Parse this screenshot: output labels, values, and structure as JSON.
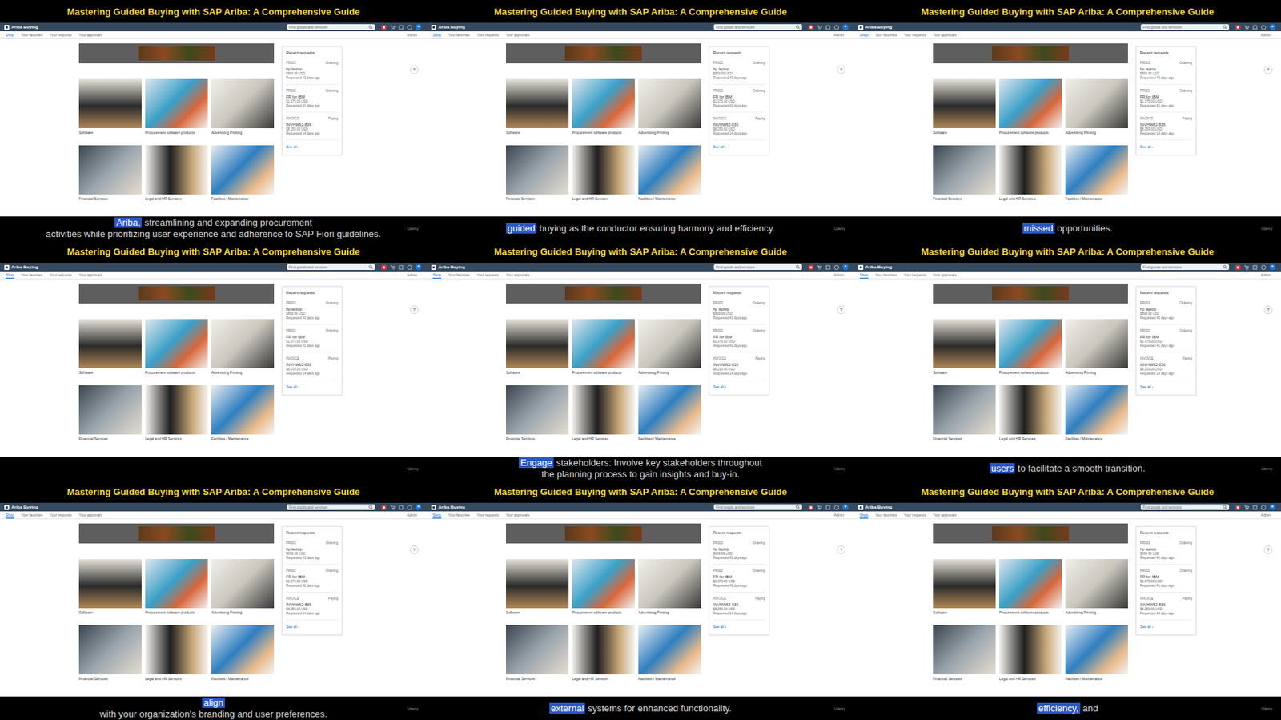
{
  "course_title": "Mastering Guided Buying with SAP Ariba: A Comprehensive Guide",
  "watermark": "Udemy",
  "app": {
    "logo": "Ariba Buying",
    "search": {
      "placeholder": "Find goods and services"
    },
    "user": "Admin",
    "tabs": [
      {
        "label": "Shop",
        "selected": true
      },
      {
        "label": "Your favorites",
        "selected": false
      },
      {
        "label": "Your requests",
        "selected": false
      },
      {
        "label": "Your approvals",
        "selected": false
      }
    ],
    "categories": [
      {
        "label": "Software"
      },
      {
        "label": "Procurement software products"
      },
      {
        "label": "Advertising Printing"
      },
      {
        "label": "Financial Services"
      },
      {
        "label": "Legal and HR Services"
      },
      {
        "label": "Facilities / Maintenance"
      }
    ],
    "help": "?",
    "recent": {
      "title": "Recent requests",
      "items": [
        {
          "id": "PR003",
          "status": "Ordering",
          "name": "hp laptop",
          "amount": "$899.99 USD",
          "age": "Requested 43 days ago"
        },
        {
          "id": "PR002",
          "status": "Ordering",
          "name": "FR for IBM",
          "amount": "$1,375.00 USD",
          "age": "Requested 41 days ago"
        },
        {
          "id": "INVOICE",
          "status": "Paying",
          "name": "INVHW62-836",
          "amount": "$8,259.00 USD",
          "age": "Requested 14 days ago"
        }
      ],
      "see_all": "See all ›"
    }
  },
  "frames": [
    {
      "caption": [
        [
          {
            "text": "Ariba,",
            "highlighted": true
          },
          {
            "text": " streamlining and expanding procurement",
            "highlighted": false
          }
        ],
        [
          {
            "text": "activities while prioritizing user experience and adherence to SAP Fiori guidelines.",
            "highlighted": false
          }
        ]
      ]
    },
    {
      "caption": [
        [
          {
            "text": "guided",
            "highlighted": true
          },
          {
            "text": " buying as the conductor ensuring harmony and efficiency.",
            "highlighted": false
          }
        ]
      ]
    },
    {
      "caption": [
        [
          {
            "text": "missed",
            "highlighted": true
          },
          {
            "text": " opportunities.",
            "highlighted": false
          }
        ]
      ]
    },
    {
      "caption": []
    },
    {
      "caption": [
        [
          {
            "text": "Engage",
            "highlighted": true
          },
          {
            "text": " stakeholders: Involve key stakeholders throughout",
            "highlighted": false
          }
        ],
        [
          {
            "text": "the planning process to gain insights and buy-in.",
            "highlighted": false
          }
        ]
      ]
    },
    {
      "caption": [
        [
          {
            "text": "users",
            "highlighted": true
          },
          {
            "text": " to facilitate a smooth transition.",
            "highlighted": false
          }
        ]
      ]
    },
    {
      "caption": [
        [
          {
            "text": "align",
            "highlighted": true
          }
        ],
        [
          {
            "text": "with your organization's branding and user preferences.",
            "highlighted": false
          }
        ]
      ]
    },
    {
      "caption": [
        [
          {
            "text": "external",
            "highlighted": true
          },
          {
            "text": " systems for enhanced functionality.",
            "highlighted": false
          }
        ]
      ]
    },
    {
      "caption": [
        [
          {
            "text": "efficiency,",
            "highlighted": true
          },
          {
            "text": " and",
            "highlighted": false
          }
        ]
      ]
    }
  ]
}
